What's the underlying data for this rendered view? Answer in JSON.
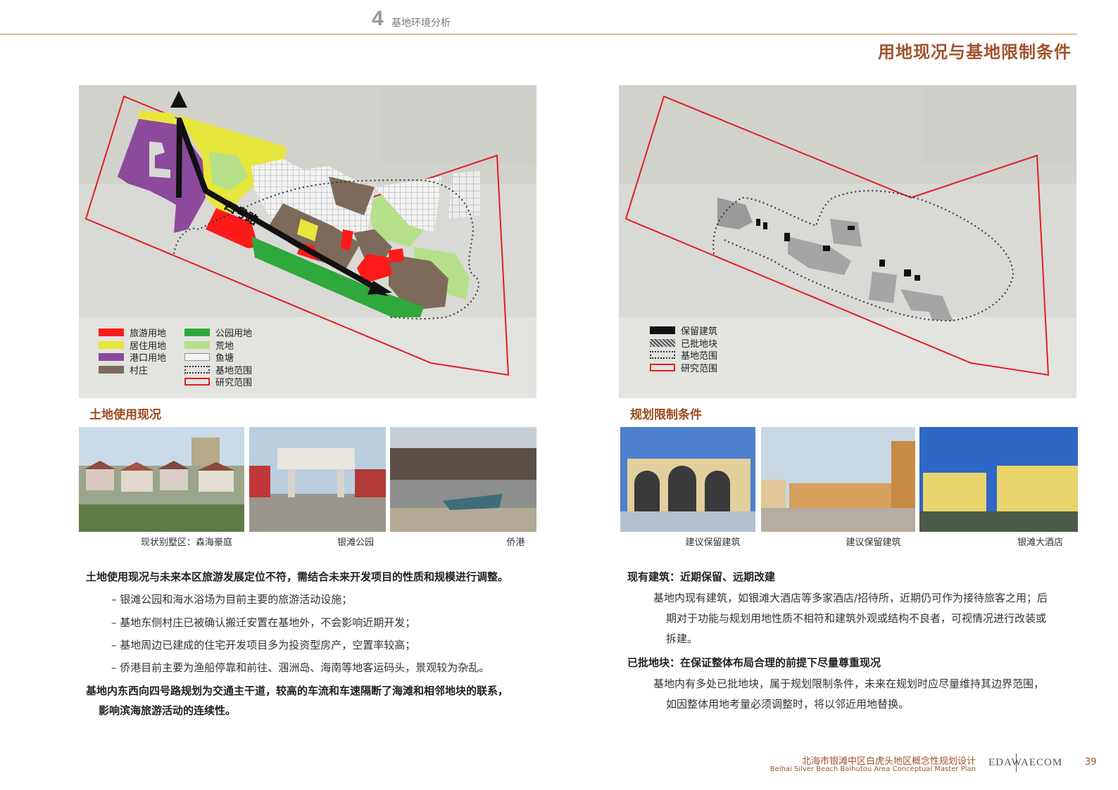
{
  "header": {
    "number": "4",
    "section": "基地环境分析",
    "page_title": "用地现况与基地限制条件"
  },
  "left": {
    "map_label": "四号路",
    "legend_col1": [
      "旅游用地",
      "居住用地",
      "港口用地",
      "村庄"
    ],
    "legend_col2": [
      "公园用地",
      "荒地",
      "鱼塘",
      "基地范围",
      "研究范围"
    ],
    "section_title": "土地使用现况",
    "captions": [
      "现状别墅区：森海豪庭",
      "银滩公园",
      "侨港"
    ],
    "heading1": "土地使用现况与未来本区旅游发展定位不符，需结合未来开发项目的性质和规模进行调整。",
    "bullets": [
      "银滩公园和海水浴场为目前主要的旅游活动设施；",
      "基地东侧村庄已被确认搬迁安置在基地外，不会影响近期开发；",
      "基地周边已建成的住宅开发项目多为投资型房产，空置率较高；",
      "侨港目前主要为渔船停靠和前往、涠洲岛、海南等地客运码头，景观较为杂乱。"
    ],
    "heading2_line1": "基地内东西向四号路规划为交通主干道，较高的车流和车速隔断了海滩和相邻地块的联系，",
    "heading2_line2": "影响滨海旅游活动的连续性。"
  },
  "right": {
    "legend": [
      "保留建筑",
      "已批地块",
      "基地范围",
      "研究范围"
    ],
    "section_title": "规划限制条件",
    "captions": [
      "建议保留建筑",
      "建议保留建筑",
      "银滩大酒店"
    ],
    "heading1": "现有建筑：近期保留、远期改建",
    "para1_line1": "基地内现有建筑，如银滩大酒店等多家酒店/招待所，近期仍可作为接待旅客之用；后",
    "para1_line2": "期对于功能与规划用地性质不相符和建筑外观或结构不良者，可视情况进行改装或",
    "para1_line3": "拆建。",
    "heading2": "已批地块：在保证整体布局合理的前提下尽量尊重现况",
    "para2_line1": "基地内有多处已批地块，属于规划限制条件，未来在规划时应尽量维持其边界范围，",
    "para2_line2": "如因整体用地考量必须调整时，将以邻近用地替换。"
  },
  "footer": {
    "title_cn": "北海市银滩中区白虎头地区概念性规划设计",
    "title_en": "Beihai Silver Beach Baihutou Area Conceptual Master Plan",
    "logo_left": "EDAW",
    "logo_right": "AECOM",
    "page_number": "39"
  },
  "colors": {
    "tourism": "#ff1a1a",
    "residential": "#e6e63c",
    "port": "#8b4a9c",
    "village": "#7d6a5a",
    "park": "#2fa83c",
    "wasteland": "#b6e08a",
    "study_boundary": "#e02020",
    "accent": "#a0522d"
  }
}
